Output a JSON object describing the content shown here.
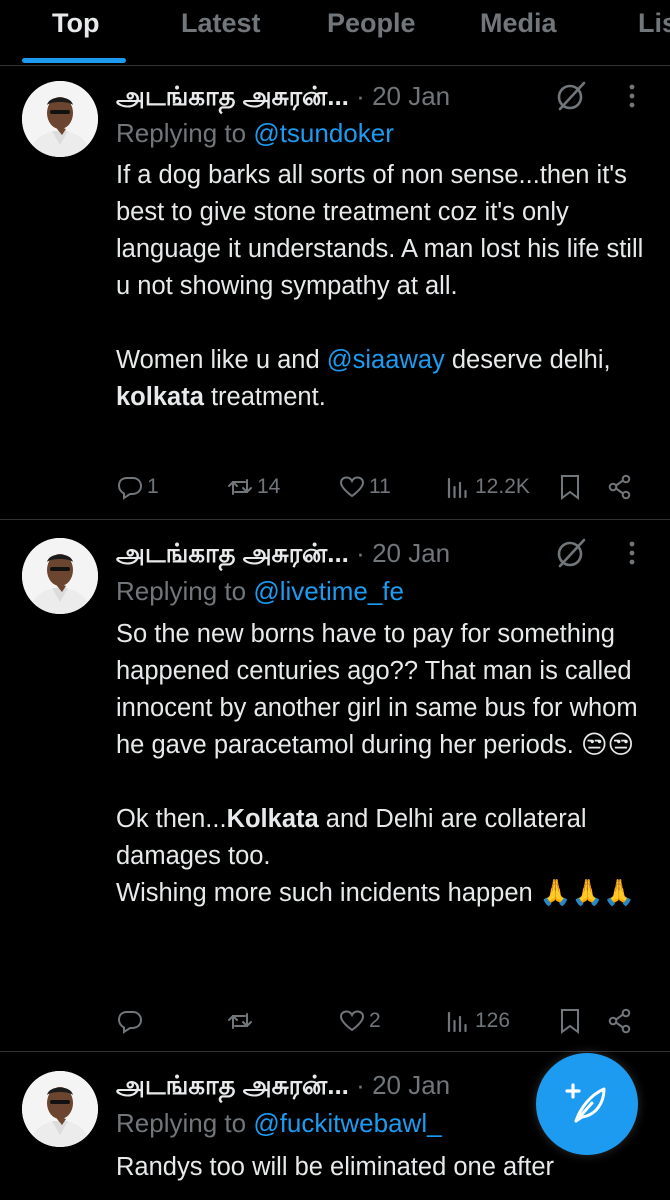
{
  "tabs": [
    {
      "label": "Top",
      "active": true
    },
    {
      "label": "Latest",
      "active": false
    },
    {
      "label": "People",
      "active": false
    },
    {
      "label": "Media",
      "active": false
    },
    {
      "label": "Lis",
      "active": false
    }
  ],
  "colors": {
    "accent": "#1d9bf0",
    "muted": "#71767b",
    "text": "#e7e9ea",
    "divider": "#2f3336",
    "background": "#000000"
  },
  "icons": {
    "grok": "grok-icon",
    "more": "more-icon",
    "reply": "reply-icon",
    "repost": "repost-icon",
    "like": "heart-icon",
    "views": "views-icon",
    "bookmark": "bookmark-icon",
    "share": "share-icon",
    "compose": "compose-icon"
  },
  "tweets": [
    {
      "author": "அடங்காத அசுரன்...",
      "separator": "·",
      "date": "20 Jan",
      "replying_prefix": "Replying to ",
      "replying_to": "@tsundoker",
      "body": {
        "line1": "If a dog barks all sorts of non sense...then it's best to give stone treatment coz it's only language it understands. A man lost his life  still u not showing sympathy at all.",
        "line2a": "Women like u and ",
        "line2_mention": "@siaaway",
        "line2b": " deserve delhi, ",
        "line2_bold": "kolkata",
        "line2c": " treatment."
      },
      "stats": {
        "replies": "1",
        "reposts": "14",
        "likes": "11",
        "views": "12.2K"
      }
    },
    {
      "author": "அடங்காத அசுரன்...",
      "separator": "·",
      "date": "20 Jan",
      "replying_prefix": "Replying to ",
      "replying_to": "@livetime_fe",
      "body": {
        "line1": "So the new borns have to pay for something happened centuries ago?? That man is called innocent by another girl in same bus for whom he gave paracetamol during her periods. 😒😒",
        "line2a": "Ok then...",
        "line2_bold": "Kolkata",
        "line2b": " and Delhi are collateral damages too.",
        "line3": "Wishing more such incidents happen 🙏🙏🙏"
      },
      "stats": {
        "replies": "",
        "reposts": "",
        "likes": "2",
        "views": "126"
      }
    },
    {
      "author": "அடங்காத அசுரன்...",
      "separator": "·",
      "date": "20 Jan",
      "replying_prefix": "Replying to ",
      "replying_to": "@fuckitwebawl_",
      "body": {
        "line1": "Randys too will be eliminated one after"
      }
    }
  ]
}
